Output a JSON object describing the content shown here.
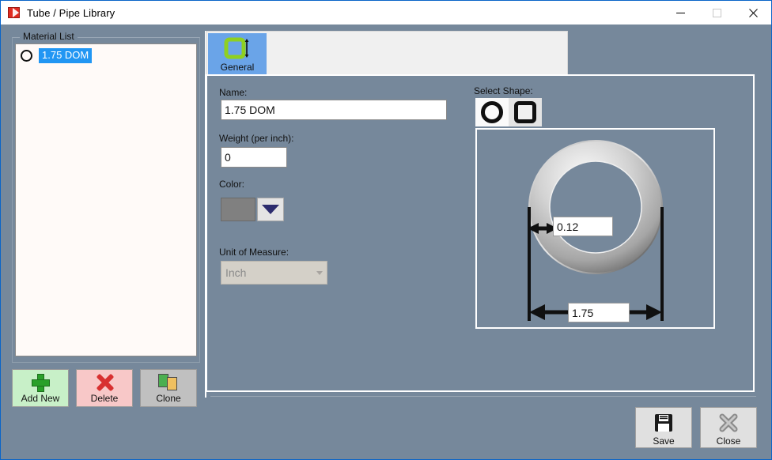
{
  "window": {
    "title": "Tube / Pipe Library",
    "app_icon": "app-logo-icon",
    "controls": {
      "minimize": "minimize-icon",
      "maximize": "maximize-icon",
      "close": "close-icon"
    },
    "accent_border": "#0a64c8",
    "background": "#76889b"
  },
  "material_list": {
    "group_label": "Material List",
    "items": [
      {
        "label": "1.75 DOM",
        "shape": "circle",
        "selected": true
      }
    ],
    "selection_color": "#2196f3"
  },
  "left_actions": [
    {
      "label": "Add New",
      "icon": "plus-icon",
      "color": "#c8f0c8"
    },
    {
      "label": "Delete",
      "icon": "x-mark-icon",
      "color": "#f8c8c8"
    },
    {
      "label": "Clone",
      "icon": "copy-documents-icon",
      "color": "#c0c0c0"
    }
  ],
  "tabs": [
    {
      "label": "General",
      "icon": "square-tube-dimension-icon",
      "selected": true
    }
  ],
  "form": {
    "name": {
      "label": "Name:",
      "value": "1.75 DOM",
      "placeholder": ""
    },
    "weight": {
      "label": "Weight (per inch):",
      "value": "0",
      "placeholder": ""
    },
    "color": {
      "label": "Color:",
      "value": "#808080",
      "dropdown_icon": "chevron-down-icon"
    },
    "unit_of_measure": {
      "label": "Unit of Measure:",
      "value": "Inch",
      "disabled": true,
      "options": [
        "Inch"
      ]
    }
  },
  "select_shape": {
    "label": "Select Shape:",
    "options": [
      {
        "name": "round-tube",
        "icon": "circle-icon",
        "selected": false
      },
      {
        "name": "square-tube",
        "icon": "rounded-square-icon",
        "selected": true
      }
    ]
  },
  "preview": {
    "shape": "round-tube",
    "wall_thickness": {
      "value": "0.12",
      "arrow": "double-arrow-horizontal-icon"
    },
    "outer_diameter": {
      "value": "1.75",
      "arrow": "double-arrow-horizontal-icon"
    }
  },
  "bottom_actions": [
    {
      "label": "Save",
      "icon": "floppy-disk-icon"
    },
    {
      "label": "Close",
      "icon": "x-mark-icon"
    }
  ]
}
